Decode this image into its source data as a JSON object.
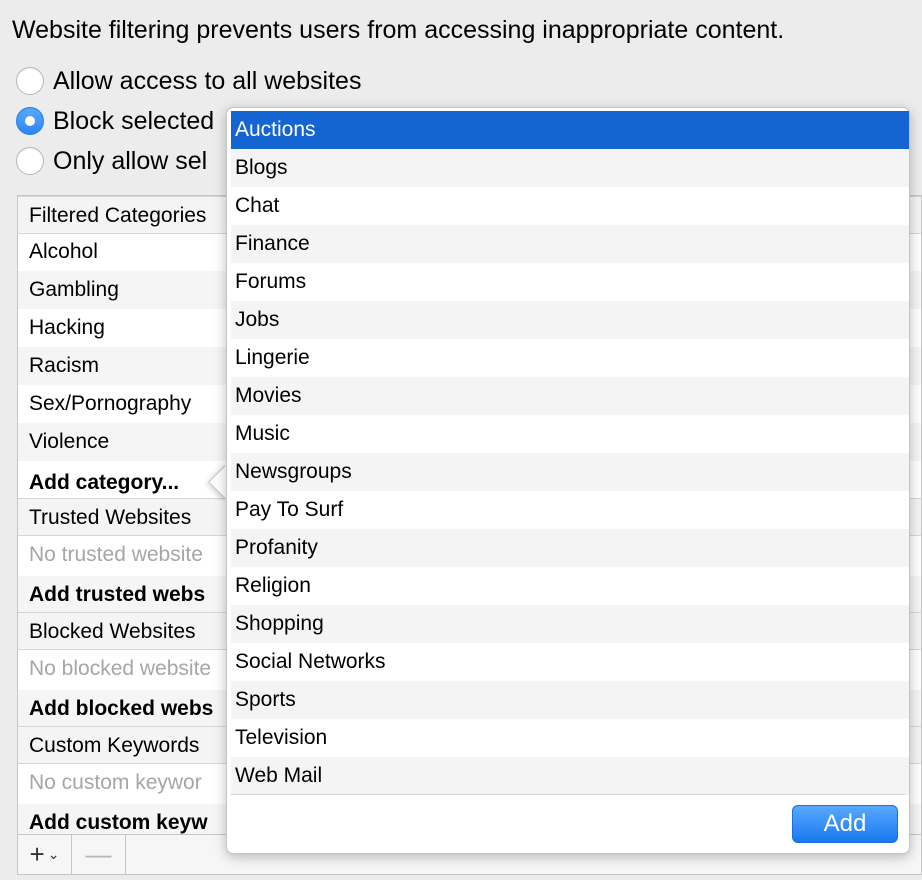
{
  "description": "Website filtering prevents users from accessing inappropriate content.",
  "radios": [
    {
      "label": "Allow access to all websites",
      "checked": false
    },
    {
      "label": "Block selected",
      "checked": true
    },
    {
      "label": "Only allow sel",
      "checked": false
    }
  ],
  "list": {
    "categories_header": "Filtered Categories",
    "categories": [
      "Alcohol",
      "Gambling",
      "Hacking",
      "Racism",
      "Sex/Pornography",
      "Violence"
    ],
    "add_category": "Add category...",
    "trusted_header": "Trusted Websites",
    "trusted_empty": "No trusted website",
    "add_trusted": "Add trusted webs",
    "blocked_header": "Blocked Websites",
    "blocked_empty": "No blocked website",
    "add_blocked": "Add blocked webs",
    "keywords_header": "Custom Keywords",
    "keywords_empty": "No custom keywor",
    "add_keywords": "Add custom keyw"
  },
  "bottom_bar": {
    "add_symbol": "+",
    "remove_symbol": "—",
    "chevron": "⌄"
  },
  "popover": {
    "items": [
      "Auctions",
      "Blogs",
      "Chat",
      "Finance",
      "Forums",
      "Jobs",
      "Lingerie",
      "Movies",
      "Music",
      "Newsgroups",
      "Pay To Surf",
      "Profanity",
      "Religion",
      "Shopping",
      "Social Networks",
      "Sports",
      "Television",
      "Web Mail"
    ],
    "selected": "Auctions",
    "add_button": "Add"
  },
  "colors": {
    "selection": "#1465d2",
    "accent": "#2a86f3"
  }
}
